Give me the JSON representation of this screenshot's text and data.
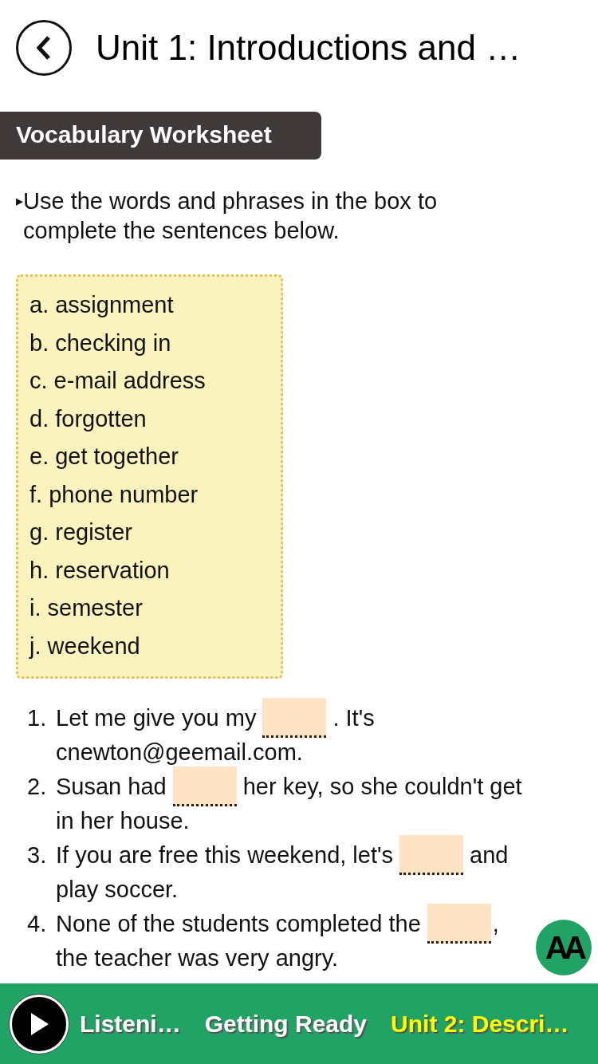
{
  "header": {
    "title": "Unit 1: Introductions and …"
  },
  "section_tab": {
    "label": "Vocabulary Worksheet"
  },
  "instruction": {
    "bullet": "▸",
    "text": "Use the words and phrases in the box to complete the sentences below."
  },
  "word_box": {
    "items": [
      "a. assignment",
      "b. checking in",
      "c. e-mail address",
      "d. forgotten",
      "e. get together",
      "f. phone number",
      "g. register",
      "h. reservation",
      "i. semester",
      "j. weekend"
    ]
  },
  "sentences": [
    {
      "number": "1.",
      "before": "Let me give you my",
      "after": ". It's",
      "continuation": "cnewton@geemail.com."
    },
    {
      "number": "2.",
      "before": "Susan had",
      "after": "her key, so she couldn't get",
      "continuation": "in her house."
    },
    {
      "number": "3.",
      "before": "If you are free this weekend, let's",
      "after": "and",
      "continuation": "play soccer."
    },
    {
      "number": "4.",
      "before": "None of the students completed the",
      "after": ",",
      "continuation": "the teacher was very angry."
    }
  ],
  "font_size_button": {
    "label": "AA"
  },
  "bottom_bar": {
    "items": [
      {
        "label": "Listeni…",
        "color": "#ffffff"
      },
      {
        "label": "Getting Ready",
        "color": "#ffffff"
      },
      {
        "label": "Unit 2: Descri…",
        "color": "#ffff00"
      }
    ]
  }
}
